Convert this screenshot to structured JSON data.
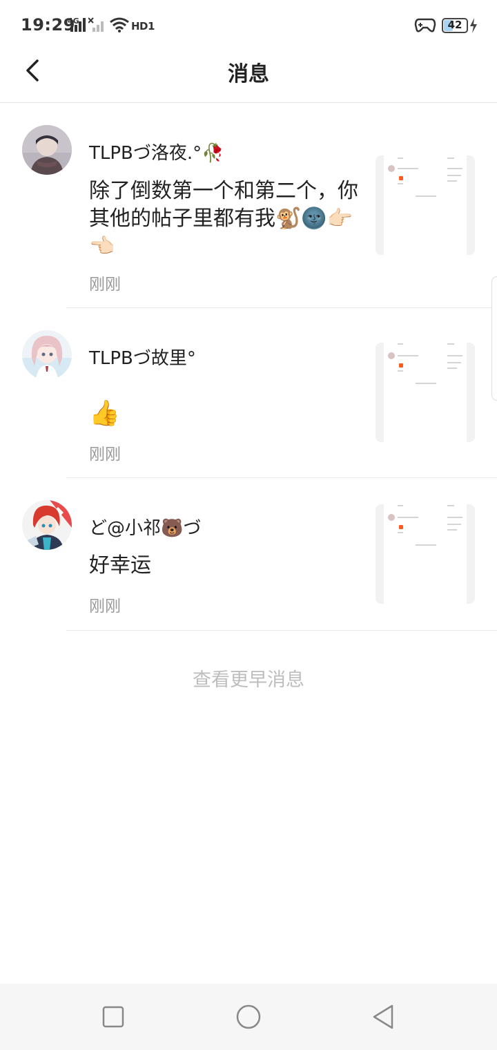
{
  "status_bar": {
    "time": "19:29",
    "network_label": "4G",
    "hd_label": "HD1",
    "battery_level": 42,
    "battery_text": "42",
    "icons": [
      "signal-icon",
      "signal-off-icon",
      "wifi-icon",
      "game-mode-icon",
      "battery-icon",
      "charging-icon"
    ]
  },
  "header": {
    "title": "消息",
    "back_icon": "chevron-left-icon"
  },
  "messages": [
    {
      "user": "TLPBづ洛夜.°🥀",
      "text": "除了倒数第一个和第二个，你其他的帖子里都有我🐒🌚👉🏻👈🏻",
      "time": "刚刚"
    },
    {
      "user": "TLPBづ故里°",
      "text": "👍",
      "time": "刚刚"
    },
    {
      "user": "ど@小祁🐻づ",
      "text": "好幸运",
      "time": "刚刚"
    }
  ],
  "load_more": "查看更早消息",
  "nav_bar": {
    "icons": [
      "recent-apps-icon",
      "home-icon",
      "back-icon"
    ]
  },
  "colors": {
    "accent": "#ff5a1f",
    "muted_text": "#9a9a9a",
    "load_more_text": "#bdbdbd",
    "battery_fill": "#a9d3f2"
  }
}
